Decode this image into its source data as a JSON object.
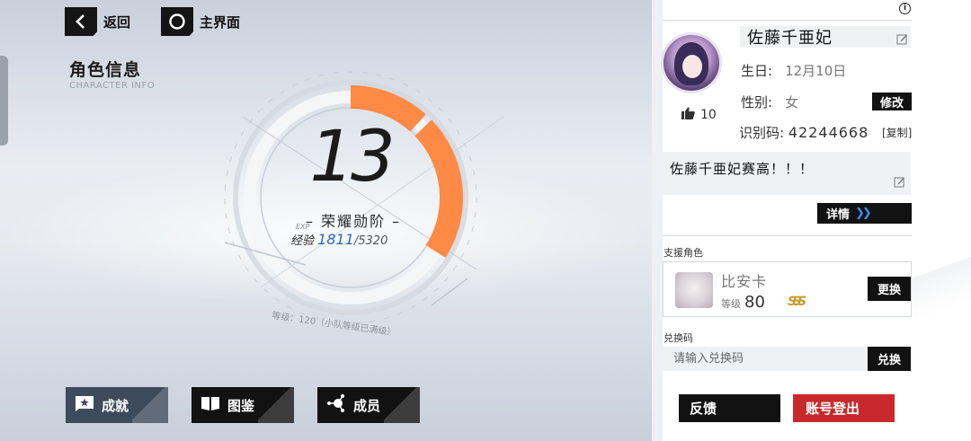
{
  "nav": {
    "back_label": "返回",
    "home_label": "主界面"
  },
  "header": {
    "title": "角色信息",
    "subtitle": "CHARACTER INFO"
  },
  "level": {
    "value": "13",
    "rank_title": "– 荣耀勋阶 –",
    "exp_label": "经验",
    "exp_tag": "EXP",
    "exp_current": "1811",
    "exp_max": "/5320",
    "exp_fraction": 0.34,
    "max_note": "等级：120（小队等级已满级）"
  },
  "bottom_tabs": [
    {
      "label": "成就",
      "icon": "star-flag-icon",
      "active": true
    },
    {
      "label": "图鉴",
      "icon": "book-icon",
      "active": false
    },
    {
      "label": "成员",
      "icon": "members-icon",
      "active": false
    }
  ],
  "profile": {
    "name": "佐藤千亜妃",
    "birthday_label": "生日:",
    "birthday_value": "12月10日",
    "gender_label": "性别:",
    "gender_value": "女",
    "modify_label": "修改",
    "likes": "10",
    "id_label": "识别码:",
    "id_value": "42244668",
    "copy_label": "[复制]",
    "signature": "佐藤千亜妃赛高！！！",
    "details_label": "详情"
  },
  "support": {
    "section_label": "支援角色",
    "name": "比安卡",
    "level_label": "等级",
    "level_value": "80",
    "rank": "SSS",
    "change_label": "更换"
  },
  "redeem": {
    "section_label": "兑换码",
    "placeholder": "请输入兑换码",
    "button_label": "兑换"
  },
  "actions": {
    "feedback_label": "反馈",
    "logout_label": "账号登出"
  },
  "colors": {
    "exp_arc": "#ff8a45",
    "exp_number": "#2b67c8",
    "logout_red": "#c8292c",
    "active_tab": "#3e4b5c"
  }
}
